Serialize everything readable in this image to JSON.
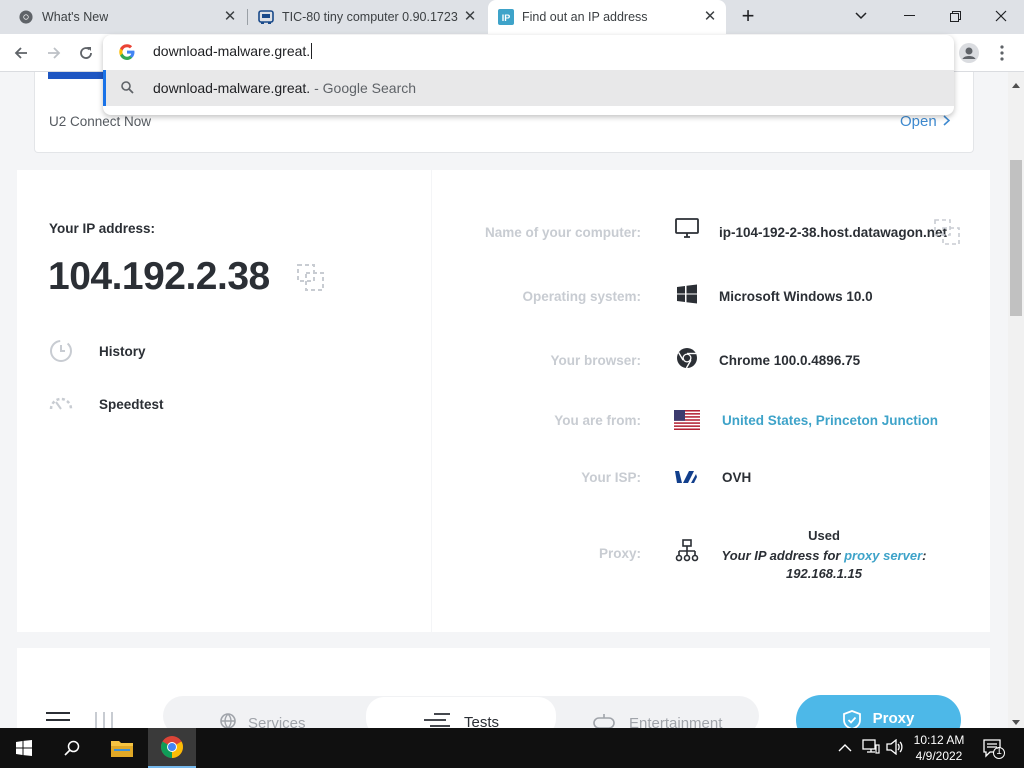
{
  "tabs": [
    {
      "title": "What's New",
      "icon": "chrome-icon"
    },
    {
      "title": "TIC-80 tiny computer 0.90.1723 (",
      "icon": "tic80-icon"
    },
    {
      "title": "Find out an IP address",
      "icon": "ip-icon",
      "active": true
    }
  ],
  "omnibox": {
    "value": "download-malware.great.",
    "suggestion_query": "download-malware.great.",
    "suggestion_source": " - Google Search"
  },
  "banner": {
    "label": "U2 Connect Now",
    "open_label": "Open"
  },
  "left_panel": {
    "ip_label": "Your IP address:",
    "ip_value": "104.192.2.38",
    "links": [
      {
        "label": "History",
        "icon": "history-icon"
      },
      {
        "label": "Speedtest",
        "icon": "speedometer-icon"
      }
    ]
  },
  "details": [
    {
      "label": "Name of your computer:",
      "value": "ip-104-192-2-38.host.datawagon.net",
      "icon": "monitor-icon"
    },
    {
      "label": "Operating system:",
      "value": "Microsoft Windows 10.0",
      "icon": "windows-icon"
    },
    {
      "label": "Your browser:",
      "value": "Chrome 100.0.4896.75",
      "icon": "chrome-icon"
    },
    {
      "label": "You are from:",
      "value": "United States, Princeton Junction",
      "icon": "us-flag-icon"
    },
    {
      "label": "Your ISP:",
      "value": "OVH",
      "icon": "ovh-logo-icon"
    },
    {
      "label": "Proxy:",
      "icon": "network-icon",
      "status": "Used",
      "desc_before": "Your IP address for ",
      "desc_link": "proxy server",
      "desc_after": ":",
      "proxy_ip": "192.168.1.15"
    }
  ],
  "bottom_nav": {
    "items": [
      {
        "label": "Services",
        "icon": "globe-icon"
      },
      {
        "label": "Tests",
        "icon": "tests-icon"
      },
      {
        "label": "Entertainment",
        "icon": "gamepad-icon"
      }
    ],
    "proxy_button": "Proxy"
  },
  "taskbar": {
    "time": "10:12 AM",
    "date": "4/9/2022",
    "notification_count": "1"
  },
  "colors": {
    "accent": "#3ea3c9",
    "proxy_button": "#4db8e8",
    "label_gray": "#c8ccd2",
    "chrome_blue": "#1a73e8"
  }
}
